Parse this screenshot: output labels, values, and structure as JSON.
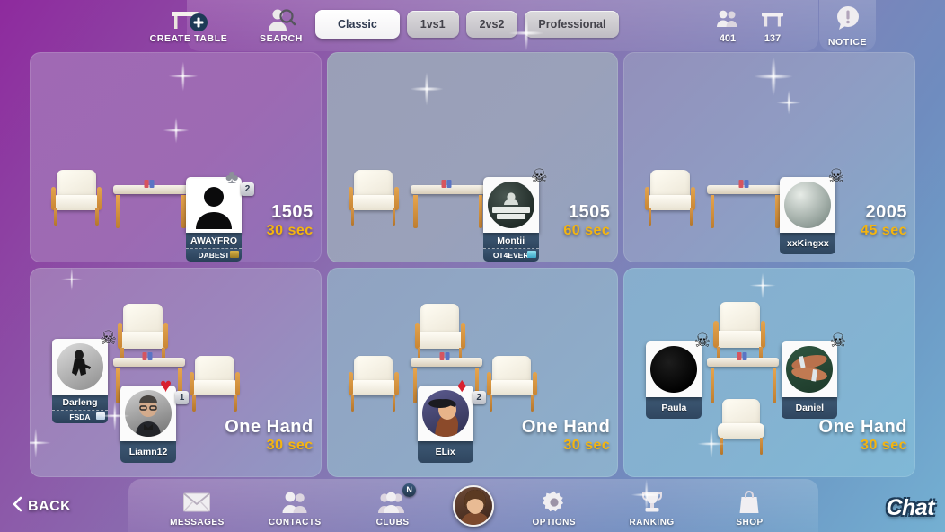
{
  "topbar": {
    "create_table": {
      "label": "CREATE TABLE",
      "icon": "table-plus-icon"
    },
    "search": {
      "label": "SEARCH",
      "icon": "search-person-icon"
    },
    "filters": [
      {
        "label": "Classic",
        "active": true
      },
      {
        "label": "1vs1",
        "active": false
      },
      {
        "label": "2vs2",
        "active": false
      },
      {
        "label": "Professional",
        "active": false
      }
    ],
    "counters": [
      {
        "icon": "people-icon",
        "value": "401"
      },
      {
        "icon": "table-icon",
        "value": "137"
      }
    ],
    "notice": {
      "label": "NOTICE",
      "icon": "speech-bubble-icon"
    }
  },
  "tables": [
    {
      "id": "table-1",
      "score": "1505",
      "time": "30 sec",
      "bg": "#9c63ad",
      "players": [
        {
          "name": "AWAYFRO",
          "club": "DABEST",
          "badge": "suit",
          "suit": "♣",
          "suit_color": "#8c9099",
          "suit_num": "2",
          "avatar": "silhouette-dark"
        }
      ]
    },
    {
      "id": "table-2",
      "score": "1505",
      "time": "60 sec",
      "bg": "#97a0b8",
      "players": [
        {
          "name": "Montii",
          "club": "OT4EVER",
          "badge": "skull",
          "avatar": "in-your-area-dark",
          "club_icon_color": "#7fd4e8"
        }
      ]
    },
    {
      "id": "table-3",
      "score": "2005",
      "time": "45 sec",
      "bg": "#8e9cc0",
      "players": [
        {
          "name": "xxKingxx",
          "club": "",
          "badge": "skull",
          "avatar": "grey-sphere"
        }
      ]
    },
    {
      "id": "table-4",
      "score": "One Hand",
      "time": "30 sec",
      "bg": "#9a84bb",
      "players": [
        {
          "name": "Darleng",
          "club": "FSDA",
          "badge": "skull",
          "avatar": "dancer-bw",
          "club_icon_color": "#cfe2f2"
        },
        {
          "name": "Liamn12",
          "club": "",
          "badge": "suit",
          "suit": "♥",
          "suit_color": "#d8202f",
          "suit_num": "1",
          "avatar": "man-glasses"
        }
      ]
    },
    {
      "id": "table-5",
      "score": "One Hand",
      "time": "30 sec",
      "bg": "#8fa7c4",
      "players": [
        {
          "name": "ELix",
          "club": "",
          "badge": "suit",
          "suit": "♦",
          "suit_color": "#d8202f",
          "suit_num": "2",
          "avatar": "woman-cap"
        }
      ]
    },
    {
      "id": "table-6",
      "score": "One Hand",
      "time": "30 sec",
      "bg": "#85b0cf",
      "players": [
        {
          "name": "Paula",
          "club": "",
          "badge": "skull",
          "avatar": "black-circle"
        },
        {
          "name": "Daniel",
          "club": "",
          "badge": "skull",
          "avatar": "hands-photo"
        }
      ]
    }
  ],
  "bottombar": {
    "back": "BACK",
    "items": [
      {
        "label": "MESSAGES",
        "icon": "envelope-icon",
        "badge": ""
      },
      {
        "label": "CONTACTS",
        "icon": "people-icon",
        "badge": ""
      },
      {
        "label": "CLUBS",
        "icon": "group-icon",
        "badge": "N"
      },
      {
        "label": "OPTIONS",
        "icon": "gear-icon",
        "badge": ""
      },
      {
        "label": "RANKING",
        "icon": "trophy-icon",
        "badge": ""
      },
      {
        "label": "SHOP",
        "icon": "bag-icon",
        "badge": ""
      }
    ],
    "avatar": "profile-avatar",
    "chat": "Chat"
  },
  "colors": {
    "accent_time": "#f5b50f",
    "plaque": "#334d68",
    "bg_start": "#8e2a9e",
    "bg_end": "#74b0d2"
  }
}
